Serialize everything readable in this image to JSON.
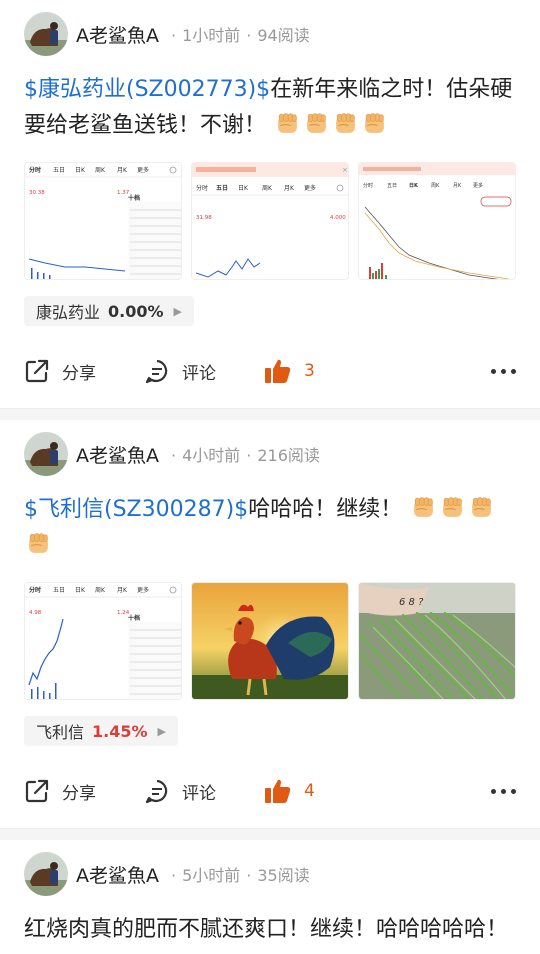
{
  "posts": [
    {
      "author": "A老鲨魚A",
      "time": "1小时前",
      "reads": "94阅读",
      "tag": "$康弘药业(SZ002773)$",
      "text": "在新年来临之时！估朵硬要给老鲨鱼送钱！不谢！",
      "emoji_count": 4,
      "stock": {
        "name": "康弘药业",
        "pct": "0.00%",
        "color": "#333333"
      },
      "share_label": "分享",
      "comment_label": "评论",
      "likes": "3",
      "thumb1": {
        "tabs": [
          "分时",
          "五日",
          "日K",
          "周K",
          "月K",
          "更多"
        ],
        "price": "30.38",
        "side": "1.37",
        "head": "十档"
      },
      "thumb2": {
        "tabs": [
          "分时",
          "五日",
          "日K",
          "周K",
          "月K",
          "更多"
        ],
        "price": "31.98",
        "side": "4.000"
      },
      "thumb3": {
        "tabs": [
          "分时",
          "五日",
          "日K",
          "周K",
          "月K",
          "更多"
        ]
      }
    },
    {
      "author": "A老鲨魚A",
      "time": "4小时前",
      "reads": "216阅读",
      "tag": "$飞利信(SZ300287)$",
      "text": "哈哈哈！继续！",
      "emoji_count": 4,
      "stock": {
        "name": "飞利信",
        "pct": "1.45%",
        "color": "#e03b3b"
      },
      "share_label": "分享",
      "comment_label": "评论",
      "likes": "4",
      "thumb1": {
        "tabs": [
          "分时",
          "五日",
          "日K",
          "周K",
          "月K",
          "更多"
        ],
        "price": "4.98",
        "side": "1.24",
        "head": "十档"
      }
    },
    {
      "author": "A老鲨魚A",
      "time": "5小时前",
      "reads": "35阅读",
      "text": "红烧肉真的肥而不腻还爽口！继续！哈哈哈哈哈！"
    }
  ],
  "icons": {
    "share": "share-icon",
    "comment": "comment-icon",
    "like": "thumbs-up-icon",
    "more": "more-dots-icon"
  },
  "colors": {
    "link": "#1f6fd1",
    "like": "#e05a12",
    "up": "#e03b3b",
    "meta": "#999999"
  }
}
